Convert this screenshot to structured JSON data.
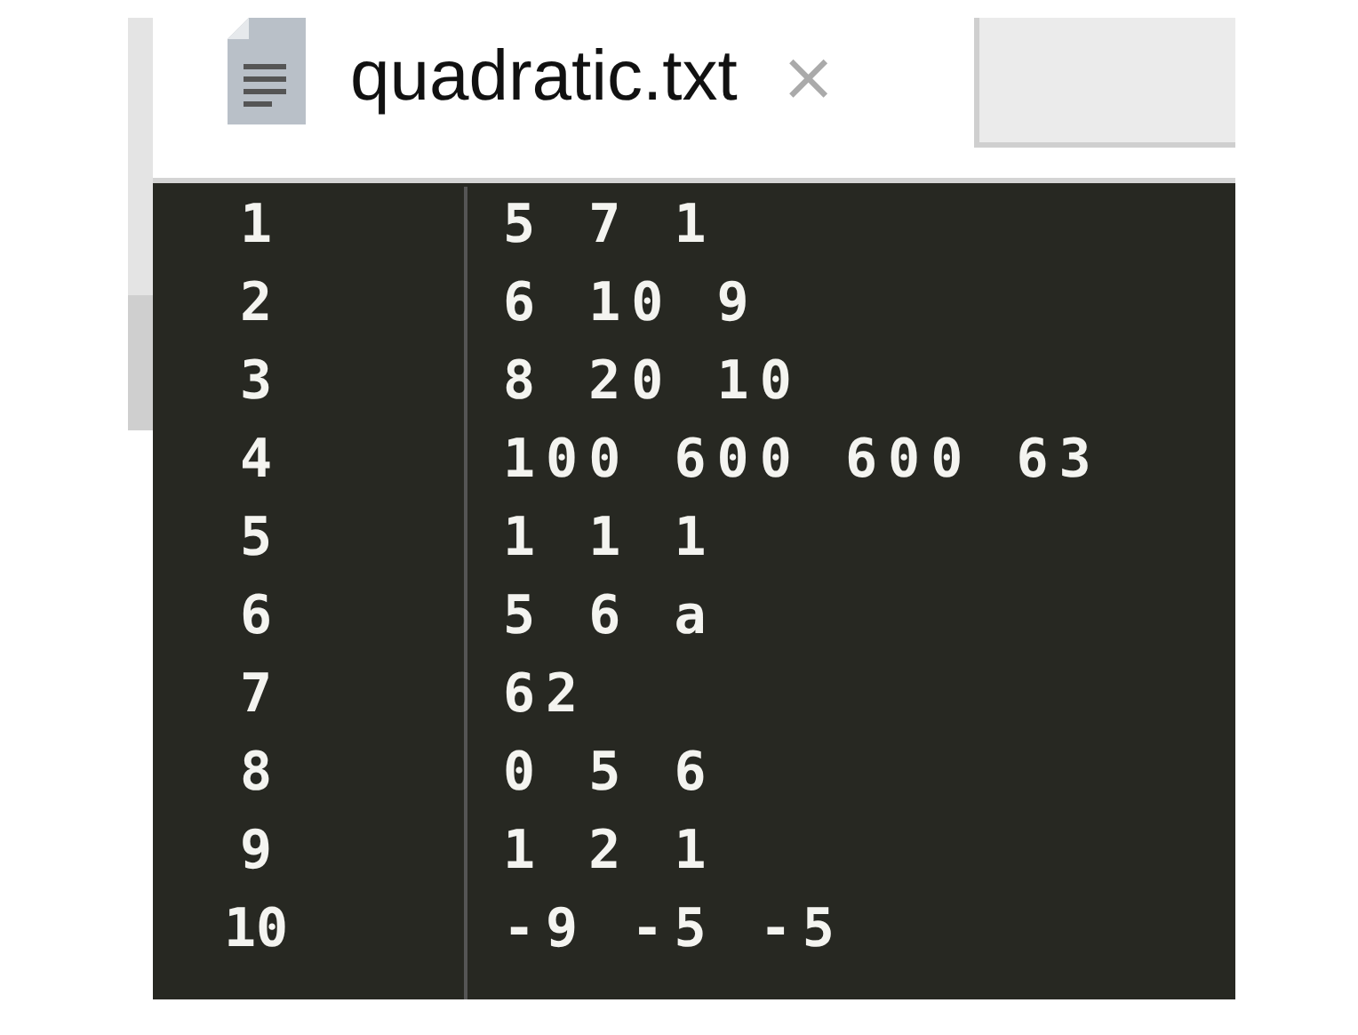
{
  "tab": {
    "title": "quadratic.txt",
    "close": "×",
    "selected": true
  },
  "editor": {
    "lines": [
      {
        "number": "1",
        "text": "5 7 1"
      },
      {
        "number": "2",
        "text": "6 10 9"
      },
      {
        "number": "3",
        "text": "8 20 10"
      },
      {
        "number": "4",
        "text": "100 600 600 63"
      },
      {
        "number": "5",
        "text": "1 1 1"
      },
      {
        "number": "6",
        "text": "5 6 a"
      },
      {
        "number": "7",
        "text": "62"
      },
      {
        "number": "8",
        "text": "0 5 6"
      },
      {
        "number": "9",
        "text": "1 2 1"
      },
      {
        "number": "10",
        "text": "-9 -5 -5"
      }
    ]
  }
}
